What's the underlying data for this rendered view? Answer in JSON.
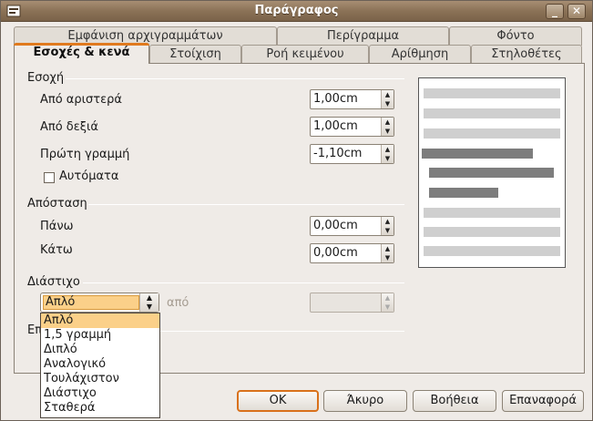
{
  "window": {
    "title": "Παράγραφος"
  },
  "tabs": {
    "row1": [
      "Εμφάνιση αρχιγραμμάτων",
      "Περίγραμμα",
      "Φόντο"
    ],
    "row2": [
      "Εσοχές & κενά",
      "Στοίχιση",
      "Ροή κειμένου",
      "Αρίθμηση",
      "Στηλοθέτες"
    ],
    "active": "Εσοχές & κενά"
  },
  "indent": {
    "heading": "Εσοχή",
    "left_label": "Από αριστερά",
    "left_value": "1,00cm",
    "right_label": "Από δεξιά",
    "right_value": "1,00cm",
    "first_label": "Πρώτη γραμμή",
    "first_value": "-1,10cm",
    "auto_label": "Αυτόματα"
  },
  "spacing": {
    "heading": "Απόσταση",
    "above_label": "Πάνω",
    "above_value": "0,00cm",
    "below_label": "Κάτω",
    "below_value": "0,00cm"
  },
  "linespacing": {
    "heading": "Διάστιχο",
    "selected": "Απλό",
    "of_label": "από",
    "options": [
      "Απλό",
      "1,5 γραμμή",
      "Διπλό",
      "Αναλογικό",
      "Τουλάχιστον",
      "Διάστιχο",
      "Σταθερά"
    ]
  },
  "register": {
    "heading_partial": "Επ"
  },
  "buttons": {
    "ok": "OK",
    "cancel": "Άκυρο",
    "help": "Βοήθεια",
    "reset": "Επαναφορά"
  },
  "colors": {
    "accent": "#e07a1e",
    "selection": "#fbd089",
    "titlebar": "#8b7257"
  }
}
